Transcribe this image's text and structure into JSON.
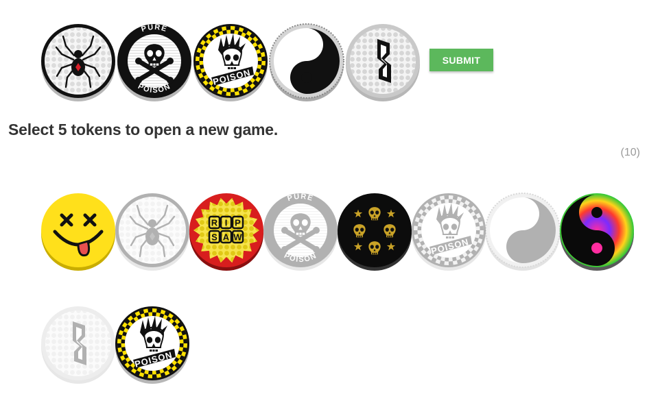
{
  "submit_label": "SUBMIT",
  "instructions": "Select 5 tokens to open a new game.",
  "token_count": "(10)",
  "selected_tokens": [
    {
      "design": "spider",
      "state": "selected"
    },
    {
      "design": "pure-poison-skull",
      "state": "selected",
      "text_top": "PURE",
      "text_bottom": "POISON"
    },
    {
      "design": "poison-punk-skull",
      "state": "selected",
      "text": "POISON"
    },
    {
      "design": "yin-yang",
      "state": "selected"
    },
    {
      "design": "s-glyph",
      "state": "selected"
    }
  ],
  "pool_tokens": [
    {
      "design": "smiley-x",
      "state": "available"
    },
    {
      "design": "spider",
      "state": "used"
    },
    {
      "design": "rip-saw",
      "state": "available",
      "text": "RIP SAW"
    },
    {
      "design": "pure-poison-skull",
      "state": "used",
      "text_top": "PURE",
      "text_bottom": "POISON"
    },
    {
      "design": "four-skulls",
      "state": "available"
    },
    {
      "design": "poison-punk-skull",
      "state": "used",
      "text": "POISON"
    },
    {
      "design": "yin-yang",
      "state": "used"
    },
    {
      "design": "rainbow-yin-yang",
      "state": "available"
    },
    {
      "design": "s-glyph",
      "state": "used"
    },
    {
      "design": "poison-punk-skull",
      "state": "available",
      "text": "POISON"
    }
  ],
  "colors": {
    "submit_bg": "#5cb85c",
    "heading": "#333333",
    "count": "#9a9a9a",
    "smiley_yellow": "#ffe01b",
    "ripsaw_red": "#d81e1e",
    "ripsaw_yellow": "#f2d91c",
    "checker_yellow": "#ffe100",
    "four_skulls_gold": "#c9a227"
  }
}
